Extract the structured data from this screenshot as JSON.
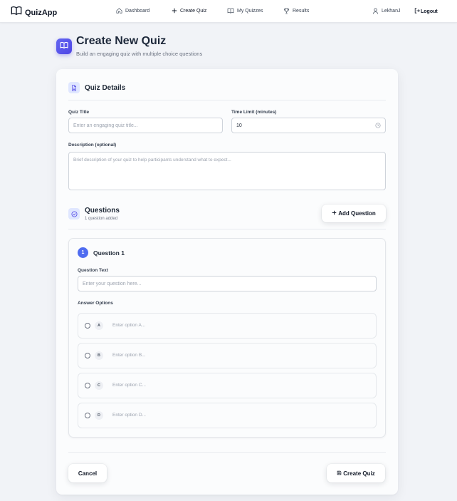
{
  "nav": {
    "brand": "QuizApp",
    "links": [
      "Dashboard",
      "Create Quiz",
      "My Quizzes",
      "Results"
    ],
    "user": "LekhanJ",
    "logout": "Logout"
  },
  "header": {
    "title": "Create New Quiz",
    "subtitle": "Build an engaging quiz with multiple choice questions"
  },
  "details": {
    "title": "Quiz Details",
    "quiz_title_label": "Quiz Title",
    "quiz_title_placeholder": "Enter an engaging quiz title...",
    "time_limit_label": "Time Limit (minutes)",
    "time_limit_value": "10",
    "description_label": "Description (optional)",
    "description_placeholder": "Brief description of your quiz to help participants understand what to expect..."
  },
  "questions": {
    "title": "Questions",
    "count": "1 question added",
    "add_label": "Add Question",
    "items": [
      {
        "number": "1",
        "title": "Question 1",
        "text_label": "Question Text",
        "text_placeholder": "Enter your question here...",
        "options_label": "Answer Options",
        "options": [
          {
            "letter": "A",
            "placeholder": "Enter option A..."
          },
          {
            "letter": "B",
            "placeholder": "Enter option B..."
          },
          {
            "letter": "C",
            "placeholder": "Enter option C..."
          },
          {
            "letter": "D",
            "placeholder": "Enter option D..."
          }
        ]
      }
    ]
  },
  "footer": {
    "cancel": "Cancel",
    "create": "Create Quiz"
  },
  "colors": {
    "accent": "#4f46e5",
    "badge": "#4f6cf0",
    "icon_bg": "#e0e7ff",
    "background": "#f1f3f7"
  },
  "icons": {
    "brand": "open-book-icon",
    "dashboard": "home-icon",
    "create": "plus-icon",
    "quizzes": "book-icon",
    "results": "trophy-icon",
    "user": "user-icon",
    "logout": "logout-icon",
    "details": "document-icon",
    "questions": "check-circle-icon",
    "time": "clock-icon",
    "save": "save-icon"
  }
}
